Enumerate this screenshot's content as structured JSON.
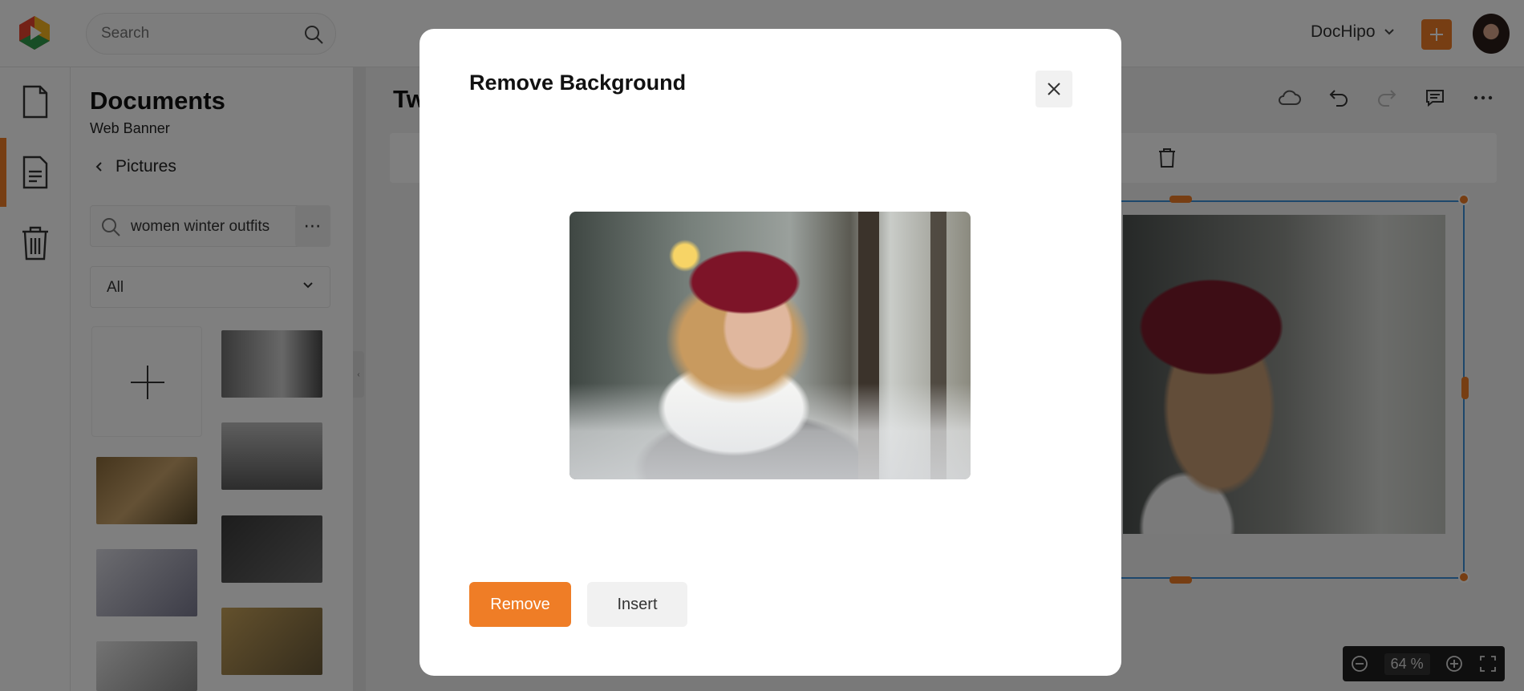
{
  "header": {
    "search_placeholder": "Search",
    "brand_name": "DocHipo"
  },
  "sidebar_panel": {
    "title": "Documents",
    "subtitle": "Web Banner",
    "back_label": "Pictures",
    "search_value": "women winter outfits",
    "filter_value": "All"
  },
  "workspace": {
    "doc_title": "Tw",
    "zoom_value": "64",
    "zoom_unit": "%"
  },
  "modal": {
    "title": "Remove Background",
    "remove_label": "Remove",
    "insert_label": "Insert"
  },
  "colors": {
    "accent": "#ef7d26",
    "selection": "#3a8fd6"
  }
}
